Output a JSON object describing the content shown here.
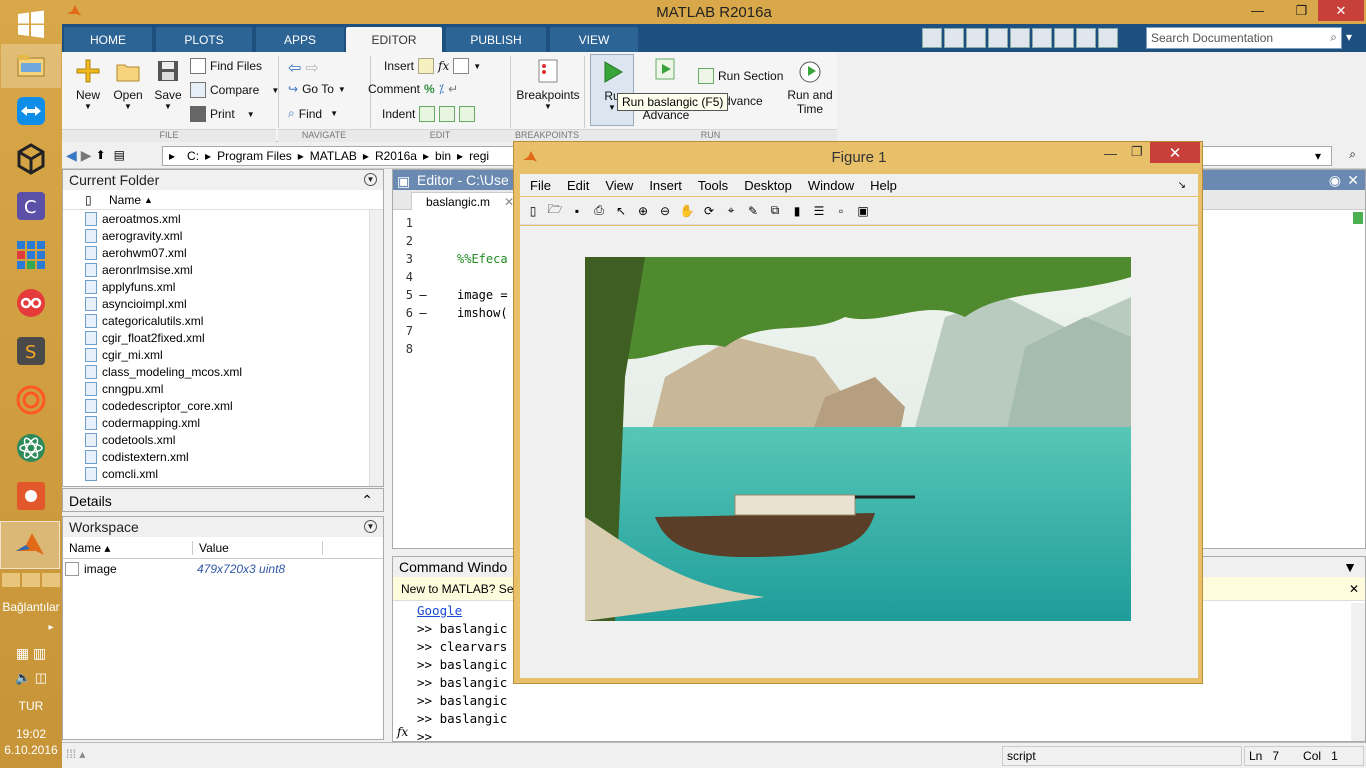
{
  "app": {
    "title": "MATLAB R2016a"
  },
  "taskbar": {
    "label_connections": "Bağlantılar",
    "lang": "TUR",
    "time": "19:02",
    "date": "6.10.2016"
  },
  "ribbon": {
    "tabs": [
      "HOME",
      "PLOTS",
      "APPS",
      "EDITOR",
      "PUBLISH",
      "VIEW"
    ],
    "search_placeholder": "Search Documentation",
    "file": {
      "new": "New",
      "open": "Open",
      "save": "Save",
      "find_files": "Find Files",
      "compare": "Compare",
      "print": "Print",
      "label": "FILE"
    },
    "navigate": {
      "goto": "Go To",
      "find": "Find",
      "label": "NAVIGATE"
    },
    "edit": {
      "insert": "Insert",
      "comment": "Comment",
      "indent": "Indent",
      "fx": "fx",
      "label": "EDIT"
    },
    "breakpoints": {
      "button": "Breakpoints",
      "label": "BREAKPOINTS"
    },
    "run": {
      "run": "Ru",
      "run_advance": "Run and Advance",
      "run_section": "Run Section",
      "advance": "Advance",
      "run_time_1": "Run and",
      "run_time_2": "Time",
      "label": "RUN"
    },
    "tooltip": "Run baslangic (F5)"
  },
  "address": {
    "segments": [
      "C:",
      "Program Files",
      "MATLAB",
      "R2016a",
      "bin",
      "regi"
    ]
  },
  "current_folder": {
    "title": "Current Folder",
    "col_name": "Name",
    "files": [
      "aeroatmos.xml",
      "aerogravity.xml",
      "aerohwm07.xml",
      "aeronrlmsise.xml",
      "applyfuns.xml",
      "asyncioimpl.xml",
      "categoricalutils.xml",
      "cgir_float2fixed.xml",
      "cgir_mi.xml",
      "class_modeling_mcos.xml",
      "cnngpu.xml",
      "codedescriptor_core.xml",
      "codermapping.xml",
      "codetools.xml",
      "codistextern.xml",
      "comcli.xml"
    ]
  },
  "details": {
    "title": "Details"
  },
  "workspace": {
    "title": "Workspace",
    "col_name": "Name",
    "col_value": "Value",
    "rows": [
      {
        "name": "image",
        "value": "479x720x3 uint8"
      }
    ]
  },
  "editor": {
    "title": "Editor - C:\\Use",
    "tab": "baslangic.m",
    "lines": [
      {
        "n": "1",
        "dash": "",
        "code": ""
      },
      {
        "n": "2",
        "dash": "",
        "code": ""
      },
      {
        "n": "3",
        "dash": "",
        "code": "%%Efeca"
      },
      {
        "n": "4",
        "dash": "",
        "code": ""
      },
      {
        "n": "5",
        "dash": "–",
        "code": "image ="
      },
      {
        "n": "6",
        "dash": "–",
        "code": "imshow("
      },
      {
        "n": "7",
        "dash": "",
        "code": ""
      },
      {
        "n": "8",
        "dash": "",
        "code": ""
      }
    ]
  },
  "command": {
    "title": "Command Windo",
    "hint": "New to MATLAB? Se",
    "link": "Google",
    "lines": [
      ">> baslangic",
      ">> clearvars",
      ">> baslangic",
      ">> baslangic",
      ">> baslangic",
      ">> baslangic"
    ],
    "prompt": ">>",
    "fx": "fx"
  },
  "status": {
    "mode": "script",
    "ln_label": "Ln",
    "ln": "7",
    "col_label": "Col",
    "col": "1"
  },
  "figure": {
    "title": "Figure 1",
    "menus": [
      "File",
      "Edit",
      "View",
      "Insert",
      "Tools",
      "Desktop",
      "Window",
      "Help"
    ]
  }
}
